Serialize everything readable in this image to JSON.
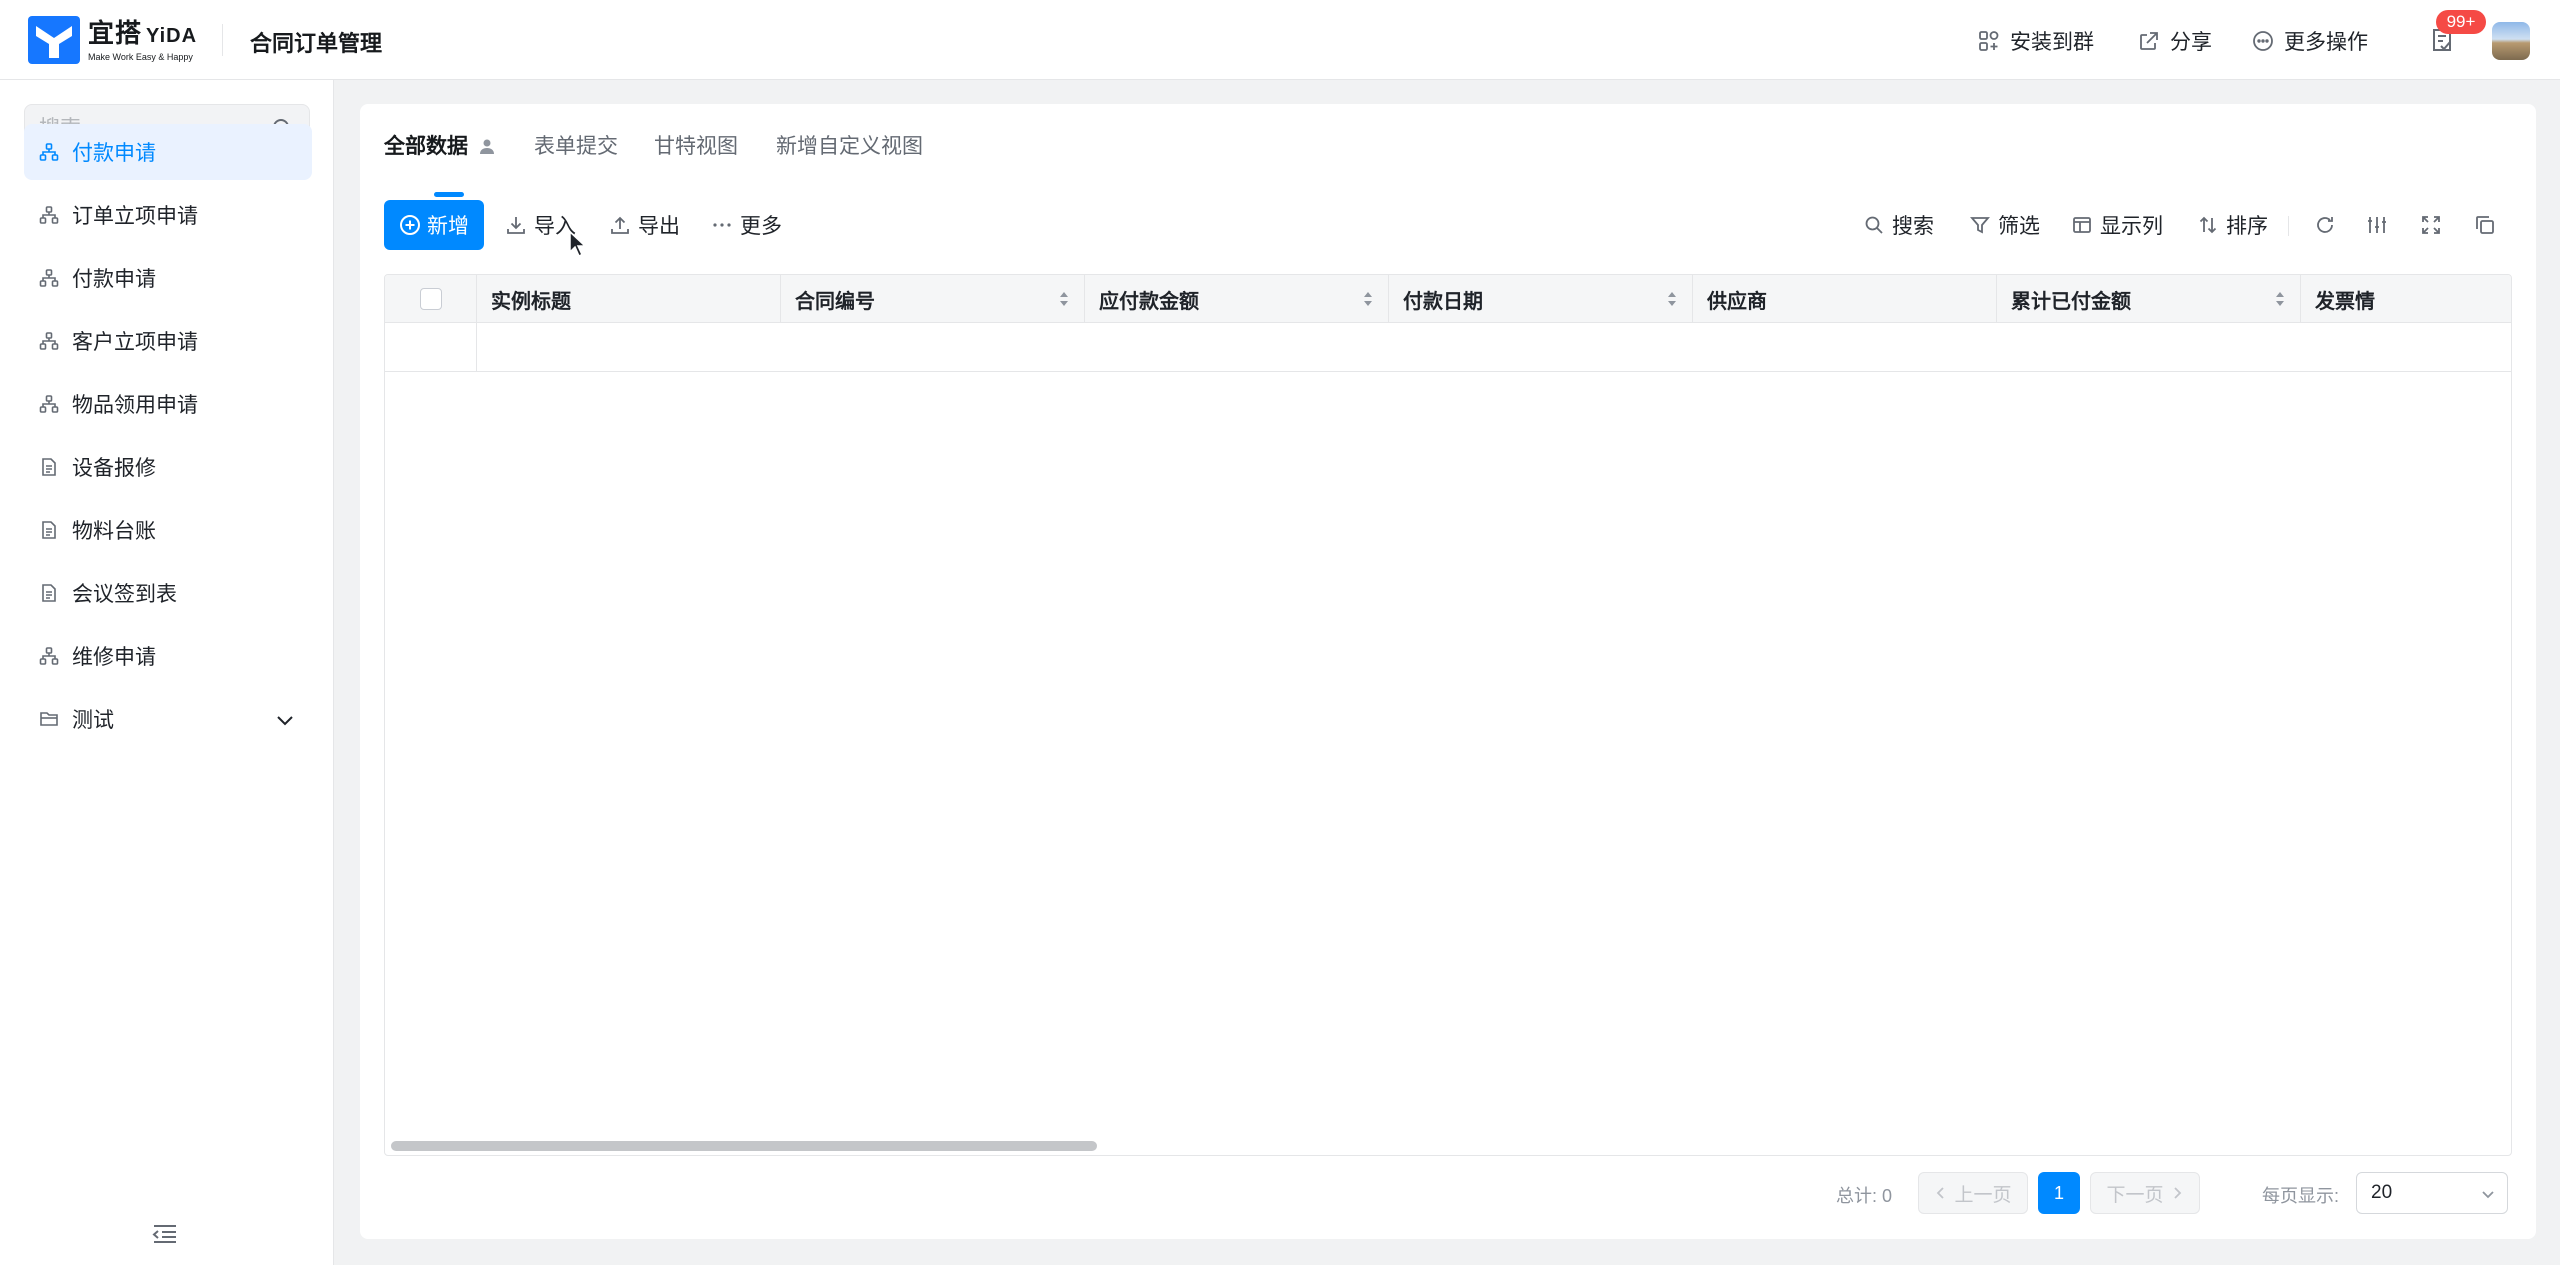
{
  "header": {
    "logo_main": "宜搭",
    "logo_en": "YiDA",
    "logo_sub": "Make Work Easy & Happy",
    "app_title": "合同订单管理",
    "install_label": "安装到群",
    "share_label": "分享",
    "more_label": "更多操作",
    "badge": "99+"
  },
  "sidebar": {
    "search_placeholder": "搜索",
    "items": [
      {
        "label": "付款申请",
        "icon": "flow-icon",
        "active": true
      },
      {
        "label": "订单立项申请",
        "icon": "flow-icon"
      },
      {
        "label": "付款申请",
        "icon": "flow-icon"
      },
      {
        "label": "客户立项申请",
        "icon": "flow-icon"
      },
      {
        "label": "物品领用申请",
        "icon": "flow-icon"
      },
      {
        "label": "设备报修",
        "icon": "form-icon"
      },
      {
        "label": "物料台账",
        "icon": "form-icon"
      },
      {
        "label": "会议签到表",
        "icon": "form-icon"
      },
      {
        "label": "维修申请",
        "icon": "flow-icon"
      },
      {
        "label": "测试",
        "icon": "folder-icon",
        "expandable": true
      }
    ]
  },
  "main": {
    "tabs": [
      {
        "label": "全部数据",
        "active": true
      },
      {
        "label": "表单提交"
      },
      {
        "label": "甘特视图"
      },
      {
        "label": "新增自定义视图"
      }
    ],
    "toolbar": {
      "new_label": "新增",
      "import_label": "导入",
      "export_label": "导出",
      "more_label": "更多",
      "search_label": "搜索",
      "filter_label": "筛选",
      "columns_label": "显示列",
      "sort_label": "排序"
    },
    "table": {
      "columns": [
        "实例标题",
        "合同编号",
        "应付款金额",
        "付款日期",
        "供应商",
        "累计已付金额",
        "发票情"
      ],
      "rows": []
    },
    "pagination": {
      "total": "总计: 0",
      "prev": "上一页",
      "page": "1",
      "next": "下一页",
      "per_page_label": "每页显示:",
      "per_page_value": "20"
    }
  },
  "colors": {
    "accent": "#0089ff",
    "badge": "#f54a45",
    "active_bg": "#eaf2ff"
  }
}
